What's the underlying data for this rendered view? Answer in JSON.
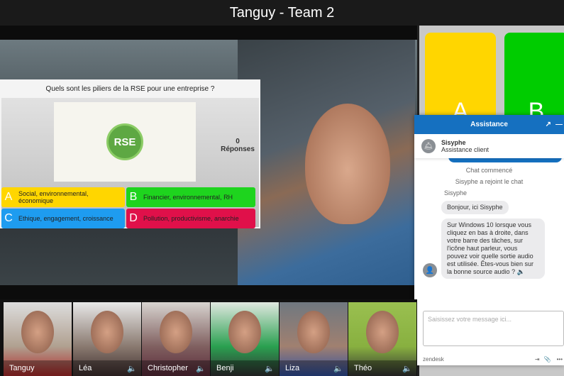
{
  "window": {
    "title": "Tanguy - Team 2"
  },
  "quiz": {
    "question": "Quels sont les piliers de la RSE pour une entreprise ?",
    "image_label": "RSE",
    "responses_count": "0",
    "responses_label": "Réponses",
    "answers": [
      {
        "letter": "A",
        "text": "Social, environnemental, économique",
        "color": "#ffd600"
      },
      {
        "letter": "B",
        "text": "Financier, environnemental, RH",
        "color": "#1ed41e"
      },
      {
        "letter": "C",
        "text": "Ethique, engagement, croissance",
        "color": "#1e9cf0"
      },
      {
        "letter": "D",
        "text": "Pollution, productivisme, anarchie",
        "color": "#e0104a"
      }
    ]
  },
  "side_tiles": [
    {
      "letter": "A",
      "color": "#ffd600"
    },
    {
      "letter": "B",
      "color": "#00cc00"
    }
  ],
  "chat": {
    "title": "Assistance",
    "agent_name": "Sisyphe",
    "agent_role": "Assistance client",
    "system": [
      "Chat commencé",
      "Sisyphe a rejoint le chat"
    ],
    "sender": "Sisyphe",
    "messages": [
      "Bonjour, ici Sisyphe",
      "Sur Windows 10 lorsque vous cliquez en bas à droite, dans votre barre des tâches, sur l'icône haut parleur, vous pouvez voir quelle sortie audio est utilisée. Êtes-vous bien sur la bonne source audio ? 🔈"
    ],
    "input_placeholder": "Saisissez votre message ici...",
    "brand": "zendesk",
    "accent": "#1570c0"
  },
  "participants": [
    {
      "name": "Tanguy"
    },
    {
      "name": "Léa"
    },
    {
      "name": "Christopher"
    },
    {
      "name": "Benji"
    },
    {
      "name": "Liza"
    },
    {
      "name": "Théo"
    }
  ]
}
